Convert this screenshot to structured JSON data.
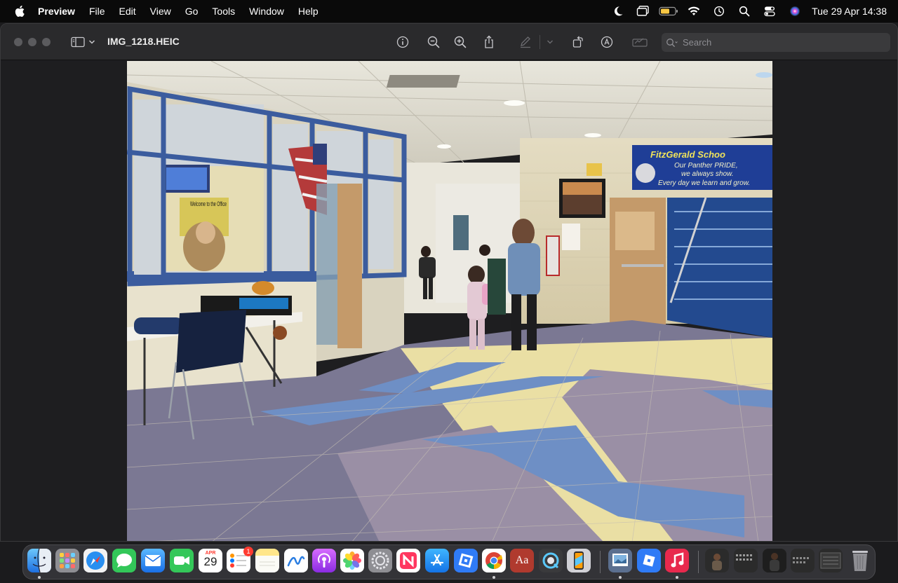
{
  "menubar": {
    "app_name": "Preview",
    "menus": [
      "File",
      "Edit",
      "View",
      "Go",
      "Tools",
      "Window",
      "Help"
    ],
    "clock": "Tue 29 Apr  14:38"
  },
  "window": {
    "title": "IMG_1218.HEIC",
    "search_placeholder": "Search"
  },
  "photo": {
    "banner_line1": "FitzGerald Schoo",
    "banner_line2": "Our Panther PRIDE,",
    "banner_line3": "we always show.",
    "banner_line4": "Every day we learn and grow.",
    "office_sign": "Welcome to the Office"
  },
  "dock": {
    "calendar_month": "APR",
    "calendar_day": "29",
    "reminders_badge": "1",
    "dictionary_label": "Aa"
  }
}
